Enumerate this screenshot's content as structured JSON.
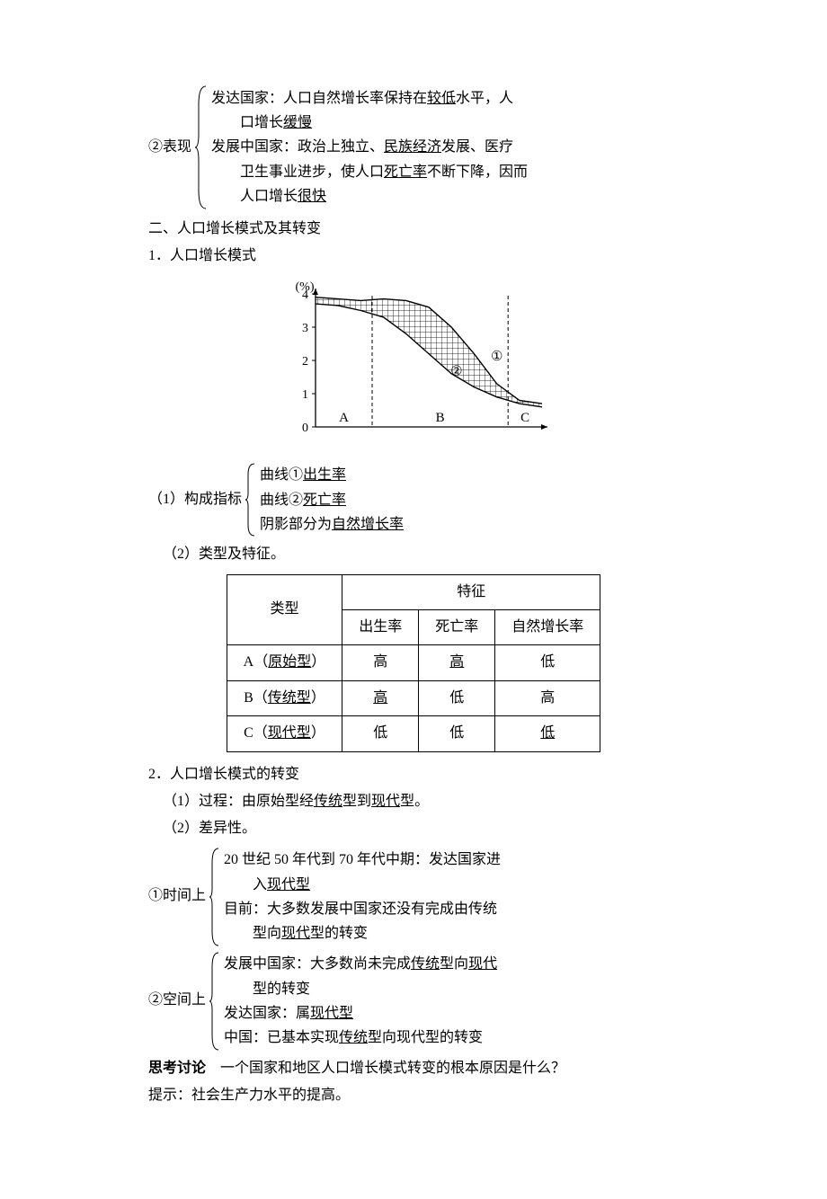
{
  "block1": {
    "label": "②表现",
    "lines": [
      "发达国家：人口自然增长率保持在<u>较低</u>水平，人",
      "<span class='sub-indent'>口增长<u>缓慢</u></span>",
      "发展中国家：政治上独立、<u>民族经济</u>发展、医疗",
      "<span class='sub-indent'>卫生事业进步，使人口<u>死亡率</u>不断下降，因而</span>",
      "<span class='sub-indent'>人口增长<u>很快</u></span>"
    ]
  },
  "h2": "二、人口增长模式及其转变",
  "s1": "1．人口增长模式",
  "chart_data": {
    "type": "area",
    "ylabel": "(%)",
    "ylim": [
      0,
      4
    ],
    "yticks": [
      0,
      1,
      2,
      3,
      4
    ],
    "regions": [
      "A",
      "B",
      "C"
    ],
    "series": [
      {
        "name": "①",
        "label": "出生率",
        "x": [
          0,
          10,
          20,
          30,
          40,
          50,
          60,
          70,
          80,
          90,
          100
        ],
        "y": [
          3.9,
          3.85,
          3.8,
          3.85,
          3.8,
          3.6,
          3.0,
          2.2,
          1.3,
          0.8,
          0.7
        ]
      },
      {
        "name": "②",
        "label": "死亡率",
        "x": [
          0,
          10,
          20,
          30,
          40,
          50,
          60,
          70,
          80,
          90,
          100
        ],
        "y": [
          3.7,
          3.65,
          3.5,
          3.3,
          2.8,
          2.2,
          1.6,
          1.2,
          0.9,
          0.7,
          0.6
        ]
      }
    ],
    "region_dividers_x": [
      25,
      85
    ]
  },
  "indicators": {
    "label": "（1）构成指标",
    "lines": [
      "曲线①<u>出生率</u>",
      "曲线②<u>死亡率</u>",
      "阴影部分为<u>自然增长率</u>"
    ]
  },
  "s1_2": "（2）类型及特征。",
  "table": {
    "header_type": "类型",
    "header_feature": "特征",
    "cols": [
      "出生率",
      "死亡率",
      "自然增长率"
    ],
    "rows": [
      {
        "type_prefix": "A（",
        "type_u": "原始型",
        "type_suffix": "）",
        "c1": "高",
        "c2": "高",
        "c2_u": true,
        "c3": "低"
      },
      {
        "type_prefix": "B（",
        "type_u": "传统型",
        "type_suffix": "）",
        "c1": "高",
        "c1_u": true,
        "c2": "低",
        "c3": "高"
      },
      {
        "type_prefix": "C（",
        "type_u": "现代型",
        "type_suffix": "）",
        "c1": "低",
        "c2": "低",
        "c3": "低",
        "c3_u": true
      }
    ]
  },
  "s2": "2．人口增长模式的转变",
  "s2_1": "（1）过程：由原始型经",
  "s2_1_u1": "传统",
  "s2_1_mid": "型到",
  "s2_1_u2": "现代",
  "s2_1_end": "型。",
  "s2_2": "（2）差异性。",
  "time_block": {
    "label": "①时间上",
    "lines": [
      "20 世纪 50 年代到 70 年代中期：发达国家进",
      "<span class='sub-indent'>入<u>现代型</u></span>",
      "目前：大多数发展中国家还没有完成由传统",
      "<span class='sub-indent'>型向<u>现代</u>型的转变</span>"
    ]
  },
  "space_block": {
    "label": "②空间上",
    "lines": [
      "发展中国家：大多数尚未完成<u>传统</u>型向<u>现代</u>",
      "<span class='sub-indent'>型的转变</span>",
      "发达国家：属<u>现代型</u>",
      "中国：已基本实现<u>传统</u>型向现代型的转变"
    ]
  },
  "think_label": "思考讨论",
  "think_q": "　一个国家和地区人口增长模式转变的根本原因是什么？",
  "hint": "提示：社会生产力水平的提高。"
}
